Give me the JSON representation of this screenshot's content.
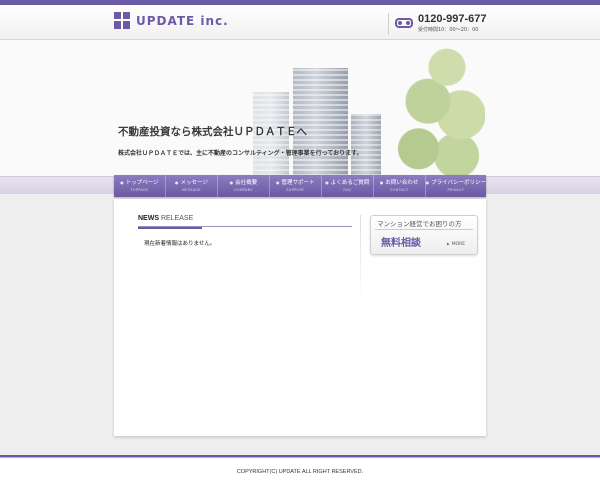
{
  "header": {
    "logo_text": "UPDATE inc.",
    "phone_number": "0120-997-677",
    "phone_hours": "受付時間10：00～20：00"
  },
  "hero": {
    "title": "不動産投資なら株式会社ＵＰＤＡＴＥへ",
    "subtitle": "株式会社ＵＰＤＡＴＥでは、主に不動産のコンサルティング・管理事業を行っております。"
  },
  "nav": {
    "items": [
      {
        "label": "トップページ",
        "sub": "TOPPAGE"
      },
      {
        "label": "メッセージ",
        "sub": "MESSAGE"
      },
      {
        "label": "会社概要",
        "sub": "COMPANY"
      },
      {
        "label": "管理サポート",
        "sub": "SUPPORT"
      },
      {
        "label": "よくあるご質問",
        "sub": "FAQ"
      },
      {
        "label": "お問い合わせ",
        "sub": "CONTACT"
      },
      {
        "label": "プライバシーポリシー",
        "sub": "PRIVACY"
      }
    ]
  },
  "news": {
    "heading_bold": "NEWS",
    "heading_light": " RELEASE",
    "empty_message": "現在新着情報はありません。"
  },
  "banner": {
    "title": "マンション経営でお困りの方",
    "main": "無料相談",
    "more": "MORE"
  },
  "footer": {
    "copyright": "COPYRIGHT(C) UPDATE ALL RIGHT RESERVED."
  },
  "colors": {
    "accent": "#6b5aa6",
    "nav_top": "#8c7cc0",
    "nav_bottom": "#6a59a3"
  }
}
